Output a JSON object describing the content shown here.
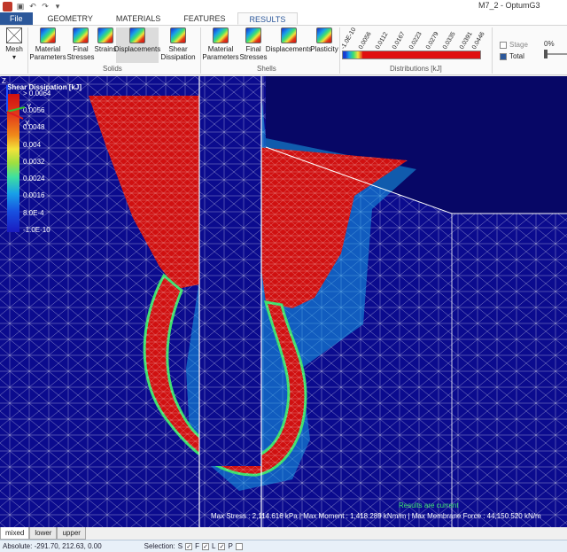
{
  "window": {
    "title": "M7_2 - OptumG3"
  },
  "tabs": [
    {
      "label": "File"
    },
    {
      "label": "GEOMETRY"
    },
    {
      "label": "MATERIALS"
    },
    {
      "label": "FEATURES"
    },
    {
      "label": "RESULTS"
    }
  ],
  "ribbon": {
    "mesh": {
      "label": "Mesh"
    },
    "solids": {
      "group_label": "Solids",
      "buttons": [
        {
          "label": "Material\nParameters"
        },
        {
          "label": "Final\nStresses"
        },
        {
          "label": "Strains"
        },
        {
          "label": "Displacements"
        },
        {
          "label": "Shear\nDissipation"
        }
      ]
    },
    "shells": {
      "group_label": "Shells",
      "buttons": [
        {
          "label": "Material\nParameters"
        },
        {
          "label": "Final\nStresses"
        },
        {
          "label": "Displacements"
        },
        {
          "label": "Plasticity"
        }
      ]
    },
    "distributions": {
      "label": "Distributions [kJ]",
      "ticks": [
        "-1.0E-10",
        "0.0056",
        "0.0112",
        "0.0167",
        "0.0223",
        "0.0279",
        "0.0335",
        "0.0391",
        "0.0446"
      ]
    },
    "stage_label": "Stage",
    "total_label": "Total",
    "slider_label": "0%"
  },
  "legend": {
    "title": "Shear Dissipation [kJ]",
    "values": [
      "> 0.0064",
      "0.0056",
      "0.0048",
      "0.004",
      "0.0032",
      "0.0024",
      "0.0016",
      "8.0E-4",
      "-1.0E-10"
    ]
  },
  "viewport": {
    "status": "Results are current",
    "max_readout": "Max Stress : 2,114.616 kPa | Max Moment : 1,418.289 kNm/m | Max Membrane Force : 44,150.520 kN/m"
  },
  "axes": {
    "z": "Z",
    "y": "Y",
    "x": "X"
  },
  "bottom_tabs": [
    {
      "label": "mixed"
    },
    {
      "label": "lower"
    },
    {
      "label": "upper"
    }
  ],
  "statusbar": {
    "coords": "Absolute: -291.70, 212.63, 0.00",
    "selection_label": "Selection:",
    "filters": [
      {
        "label": "S"
      },
      {
        "label": "F"
      },
      {
        "label": "L"
      },
      {
        "label": "P"
      }
    ]
  },
  "colors": {
    "accent": "#2b579a",
    "background": "#0b0b8e",
    "hot": "#d01010"
  }
}
